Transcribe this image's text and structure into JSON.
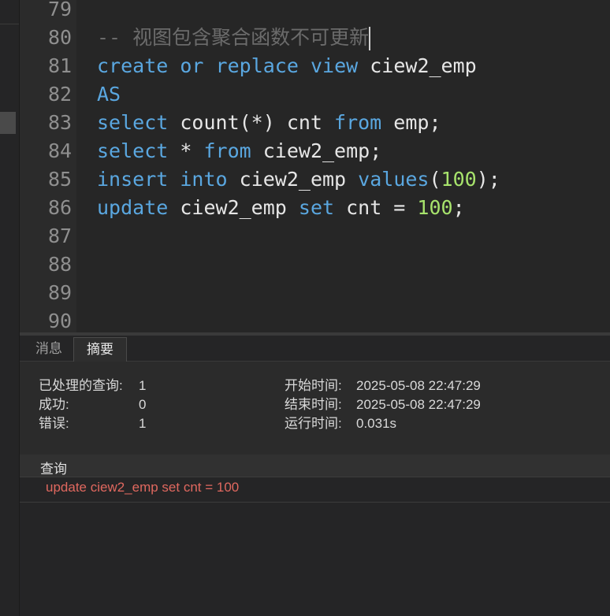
{
  "editor": {
    "lines": [
      {
        "num": "79",
        "tokens": []
      },
      {
        "num": "80",
        "tokens": [
          {
            "t": "-- 视图包含聚合函数不可更新",
            "c": "cmt"
          }
        ],
        "cursor": true
      },
      {
        "num": "81",
        "tokens": [
          {
            "t": "create",
            "c": "kw"
          },
          {
            "t": " "
          },
          {
            "t": "or",
            "c": "kw"
          },
          {
            "t": " "
          },
          {
            "t": "replace",
            "c": "kw"
          },
          {
            "t": " "
          },
          {
            "t": "view",
            "c": "kw"
          },
          {
            "t": " ciew2_emp"
          }
        ]
      },
      {
        "num": "82",
        "tokens": [
          {
            "t": "AS",
            "c": "kw"
          }
        ]
      },
      {
        "num": "83",
        "tokens": [
          {
            "t": "select",
            "c": "kw"
          },
          {
            "t": " count(*) cnt "
          },
          {
            "t": "from",
            "c": "kw"
          },
          {
            "t": " emp;"
          }
        ]
      },
      {
        "num": "84",
        "tokens": [
          {
            "t": "select",
            "c": "kw"
          },
          {
            "t": " * "
          },
          {
            "t": "from",
            "c": "kw"
          },
          {
            "t": " ciew2_emp;"
          }
        ]
      },
      {
        "num": "85",
        "tokens": [
          {
            "t": "insert",
            "c": "kw"
          },
          {
            "t": " "
          },
          {
            "t": "into",
            "c": "kw"
          },
          {
            "t": " ciew2_emp "
          },
          {
            "t": "values",
            "c": "kw"
          },
          {
            "t": "("
          },
          {
            "t": "100",
            "c": "num"
          },
          {
            "t": ");"
          }
        ]
      },
      {
        "num": "86",
        "tokens": [
          {
            "t": "update",
            "c": "kw"
          },
          {
            "t": " ciew2_emp "
          },
          {
            "t": "set",
            "c": "kw"
          },
          {
            "t": " cnt = "
          },
          {
            "t": "100",
            "c": "num"
          },
          {
            "t": ";"
          }
        ]
      },
      {
        "num": "87",
        "tokens": []
      },
      {
        "num": "88",
        "tokens": []
      },
      {
        "num": "89",
        "tokens": []
      },
      {
        "num": "90",
        "tokens": []
      }
    ]
  },
  "tabs": {
    "messages": "消息",
    "summary": "摘要"
  },
  "summary": {
    "processed_label": "已处理的查询:",
    "processed_value": "1",
    "success_label": "成功:",
    "success_value": "0",
    "error_label": "错误:",
    "error_value": "1",
    "start_label": "开始时间:",
    "start_value": "2025-05-08 22:47:29",
    "end_label": "结束时间:",
    "end_value": "2025-05-08 22:47:29",
    "elapsed_label": "运行时间:",
    "elapsed_value": "0.031s"
  },
  "query": {
    "header": "查询",
    "text": "update ciew2_emp set cnt = 100"
  },
  "colors": {
    "keyword": "#5aa7e0",
    "number": "#a7e36c",
    "comment": "#6b6b6b",
    "error_text": "#e0685f"
  }
}
